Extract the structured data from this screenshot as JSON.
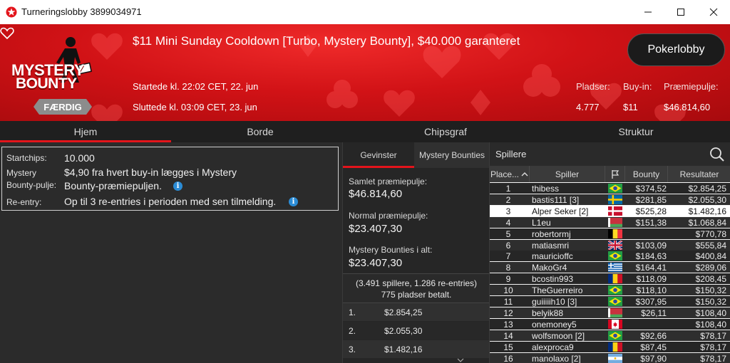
{
  "window": {
    "title": "Turneringslobby 3899034971"
  },
  "banner": {
    "logo_line1": "MYSTERY",
    "logo_line2": "BOUNTY",
    "status": "FÆRDIG",
    "title": "$11 Mini Sunday Cooldown [Turbo, Mystery Bounty], $40.000 garanteret",
    "started": "Startede kl. 22:02 CET, 22. jun",
    "ended": "Sluttede kl. 03:09 CET, 23. jun",
    "lobby_button": "Pokerlobby",
    "stats": [
      {
        "label": "Pladser:",
        "value": "4.777"
      },
      {
        "label": "Buy-in:",
        "value": "$11"
      },
      {
        "label": "Præmiepulje:",
        "value": "$46.814,60"
      }
    ]
  },
  "tabs": [
    "Hjem",
    "Borde",
    "Chipsgraf",
    "Struktur"
  ],
  "info": {
    "startchips_label": "Startchips:",
    "startchips_value": "10.000",
    "mystery_label_1": "Mystery",
    "mystery_label_2": "Bounty-pulje:",
    "mystery_value_1": "$4,90 fra hvert buy-in lægges i Mystery",
    "mystery_value_2": "Bounty-præmiepuljen.",
    "reentry_label": "Re-entry:",
    "reentry_value": "Op til 3 re-entries i perioden med sen tilmelding.",
    "info_glyph": "i"
  },
  "prizes": {
    "tabs": [
      "Gevinster",
      "Mystery Bounties"
    ],
    "total_label": "Samlet præmiepulje:",
    "total_value": "$46.814,60",
    "normal_label": "Normal præmiepulje:",
    "normal_value": "$23.407,30",
    "mystery_label": "Mystery Bounties i alt:",
    "mystery_value": "$23.407,30",
    "entries_line1": "(3.491 spillere, 1.286 re-entries)",
    "entries_line2": "775 pladser betalt.",
    "payouts": [
      {
        "place": "1.",
        "amount": "$2.854,25"
      },
      {
        "place": "2.",
        "amount": "$2.055,30"
      },
      {
        "place": "3.",
        "amount": "$1.482,16"
      }
    ]
  },
  "players": {
    "title": "Spillere",
    "columns": {
      "place": "Place...",
      "player": "Spiller",
      "bounty": "Bounty",
      "results": "Resultater"
    },
    "rows": [
      {
        "place": "1",
        "name": "thibess",
        "flag": "br",
        "bounty": "$374,52",
        "result": "$2.854,25"
      },
      {
        "place": "2",
        "name": "bastis111 [3]",
        "flag": "se",
        "bounty": "$281,85",
        "result": "$2.055,30"
      },
      {
        "place": "3",
        "name": "Alper Seker [2]",
        "flag": "dk",
        "bounty": "$525,28",
        "result": "$1.482,16"
      },
      {
        "place": "4",
        "name": "L1eu",
        "flag": "by",
        "bounty": "$151,38",
        "result": "$1.068,84"
      },
      {
        "place": "5",
        "name": "robertormj",
        "flag": "be",
        "bounty": "",
        "result": "$770,78"
      },
      {
        "place": "6",
        "name": "matiasmri",
        "flag": "gb",
        "bounty": "$103,09",
        "result": "$555,84"
      },
      {
        "place": "7",
        "name": "mauricioffc",
        "flag": "br",
        "bounty": "$184,63",
        "result": "$400,84"
      },
      {
        "place": "8",
        "name": "MakoGr4",
        "flag": "gr",
        "bounty": "$164,41",
        "result": "$289,06"
      },
      {
        "place": "9",
        "name": "bcostin993",
        "flag": "ro",
        "bounty": "$118,09",
        "result": "$208,45"
      },
      {
        "place": "10",
        "name": "TheGuerreiro",
        "flag": "br",
        "bounty": "$118,10",
        "result": "$150,32"
      },
      {
        "place": "11",
        "name": "guiiiiih10 [3]",
        "flag": "br",
        "bounty": "$307,95",
        "result": "$150,32"
      },
      {
        "place": "12",
        "name": "belyik88",
        "flag": "by",
        "bounty": "$26,11",
        "result": "$108,40"
      },
      {
        "place": "13",
        "name": "onemoney5",
        "flag": "ca",
        "bounty": "",
        "result": "$108,40"
      },
      {
        "place": "14",
        "name": "wolfsmoon [2]",
        "flag": "br",
        "bounty": "$92,66",
        "result": "$78,17"
      },
      {
        "place": "15",
        "name": "alexproca9",
        "flag": "ro",
        "bounty": "$87,45",
        "result": "$78,17"
      },
      {
        "place": "16",
        "name": "manolaxo [2]",
        "flag": "ar",
        "bounty": "$97,90",
        "result": "$78,17"
      }
    ]
  },
  "colors": {
    "accent": "#e3141b",
    "banner": "#d11216",
    "info_icon": "#2b8cd6"
  }
}
